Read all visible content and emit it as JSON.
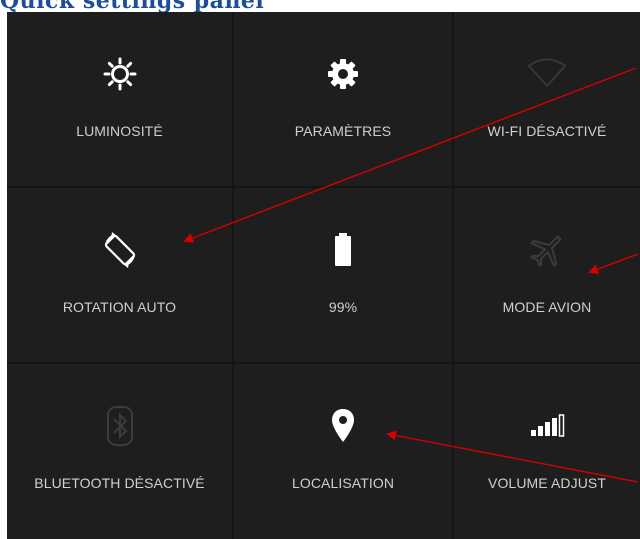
{
  "page": {
    "heading": "Quick settings panel"
  },
  "tiles": [
    {
      "label": "LUMINOSITÉ",
      "icon": "brightness-icon"
    },
    {
      "label": "PARAMÈTRES",
      "icon": "settings-gear-icon"
    },
    {
      "label": "WI-FI DÉSACTIVÉ",
      "icon": "wifi-off-icon"
    },
    {
      "label": "ROTATION AUTO",
      "icon": "auto-rotate-icon"
    },
    {
      "label": "99%",
      "icon": "battery-icon"
    },
    {
      "label": "MODE AVION",
      "icon": "airplane-icon"
    },
    {
      "label": "BLUETOOTH DÉSACTIVÉ",
      "icon": "bluetooth-off-icon"
    },
    {
      "label": "LOCALISATION",
      "icon": "location-pin-icon"
    },
    {
      "label": "VOLUME ADJUST",
      "icon": "volume-bars-icon"
    }
  ],
  "colors": {
    "panel": "#141414",
    "tile": "#1e1e1e",
    "annotation_arrow": "#d40000",
    "heading": "#1f4e94"
  }
}
